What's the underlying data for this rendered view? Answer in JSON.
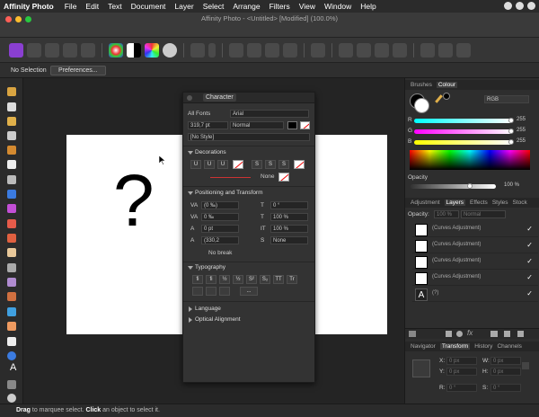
{
  "menubar": {
    "app": "Affinity Photo",
    "items": [
      "File",
      "Edit",
      "Text",
      "Document",
      "Layer",
      "Select",
      "Arrange",
      "Filters",
      "View",
      "Window",
      "Help"
    ]
  },
  "window": {
    "title": "Affinity Photo - <Untitled> [Modified] (100.0%)"
  },
  "context": {
    "selection": "No Selection",
    "preferences": "Preferences..."
  },
  "canvas": {
    "glyph": "?"
  },
  "status": {
    "drag": "Drag",
    "text1": " to marquee select. ",
    "click": "Click",
    "text2": " an object to select it."
  },
  "character": {
    "title": "Character",
    "font_collection": "All Fonts",
    "font": "Arial",
    "size": "319,7 pt",
    "style": "Normal",
    "text_style": "[No Style]",
    "decorations": "Decorations",
    "decoration_buttons": [
      "U",
      "U",
      "U",
      "S",
      "S",
      "S"
    ],
    "none_label": "None",
    "pos_transform": "Positioning and Transform",
    "tracking": "(0 ‰)",
    "kerning": "0 ‰",
    "baseline": "0 pt",
    "leading": "(330,2",
    "shear": "0 °",
    "scale_h": "100 %",
    "scale_v": "100 %",
    "case": "None",
    "nobreak": "No break",
    "typography": "Typography",
    "typo_buttons": [
      "fi",
      "ﬁ",
      "½",
      "½",
      "S²",
      "S₂",
      "TT",
      "Tr",
      "",
      "",
      "",
      "..."
    ],
    "language": "Language",
    "optical": "Optical Alignment"
  },
  "colour": {
    "tab_brushes": "Brushes",
    "tab_colour": "Colour",
    "model": "RGB",
    "r_label": "R",
    "g_label": "G",
    "b_label": "B",
    "r": "255",
    "g": "255",
    "b": "255",
    "opacity_label": "Opacity",
    "opacity": "100 %",
    "colors": {
      "r": "#e84040",
      "g": "#34c934",
      "b": "#c8c832"
    }
  },
  "layers": {
    "tabs": [
      "Adjustment",
      "Layers",
      "Effects",
      "Styles",
      "Stock"
    ],
    "opacity_label": "Opacity:",
    "opacity": "100 %",
    "blend": "Normal",
    "items": [
      {
        "name": "(Curves Adjustment)"
      },
      {
        "name": "(Curves Adjustment)"
      },
      {
        "name": "(Curves Adjustment)"
      },
      {
        "name": "(Curves Adjustment)"
      },
      {
        "name": "(?)"
      }
    ]
  },
  "transform": {
    "tabs": [
      "Navigator",
      "Transform",
      "History",
      "Channels"
    ],
    "x_label": "X:",
    "y_label": "Y:",
    "w_label": "W:",
    "h_label": "H:",
    "r_label": "R:",
    "s_label": "S:",
    "x": "0 px",
    "y": "0 px",
    "w": "0 px",
    "h": "0 px",
    "r": "0 °",
    "s": "0 °"
  }
}
